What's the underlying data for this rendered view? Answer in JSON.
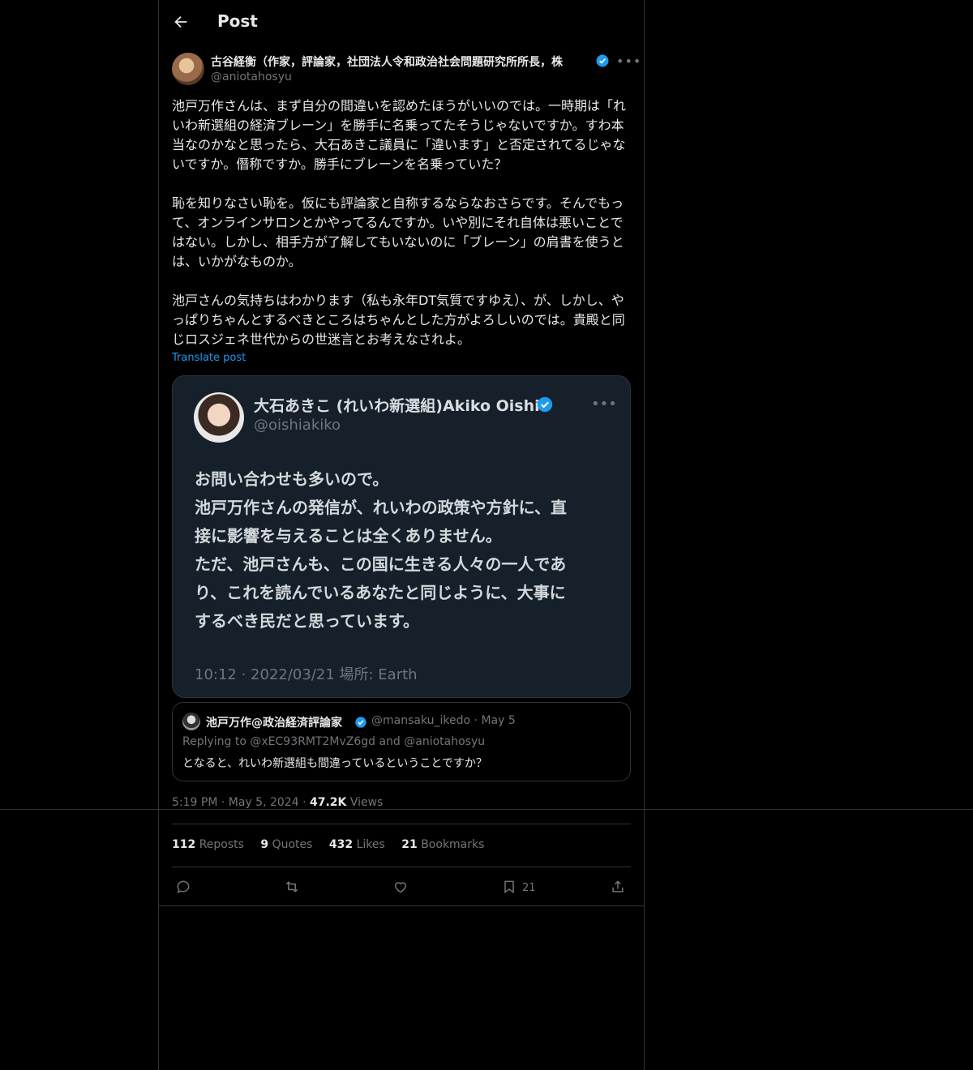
{
  "header": {
    "title": "Post"
  },
  "post": {
    "author_name": "古谷経衡（作家，評論家，社団法人令和政治社会問題研究所所長，株",
    "author_handle": "@aniotahosyu",
    "paragraphs": [
      "池戸万作さんは、まず自分の間違いを認めたほうがいいのでは。一時期は「れいわ新選組の経済ブレーン」を勝手に名乗ってたそうじゃないですか。すわ本当なのかなと思ったら、大石あきこ議員に「違います」と否定されてるじゃないですか。僭称ですか。勝手にブレーンを名乗っていた？",
      "恥を知りなさい恥を。仮にも評論家と自称するならなおさらです。そんでもって、オンラインサロンとかやってるんですか。いや別にそれ自体は悪いことではない。しかし、相手方が了解してもいないのに「ブレーン」の肩書を使うとは、いかがなものか。",
      "池戸さんの気持ちはわかります（私も永年DT気質ですゆえ）、が、しかし、やっぱりちゃんとするべきところはちゃんとした方がよろしいのでは。貴殿と同じロスジェネ世代からの世迷言とお考えなされよ。"
    ],
    "translate_label": "Translate post",
    "media": {
      "name": "大石あきこ (れいわ新選組)Akiko Oishi",
      "handle": "@oishiakiko",
      "lines": [
        "お問い合わせも多いので。",
        "池戸万作さんの発信が、れいわの政策や方針に、直",
        "接に影響を与えることは全くありません。",
        "ただ、池戸さんも、この国に生きる人々の一人であ",
        "り、これを読んでいるあなたと同じように、大事に",
        "するべき民だと思っています。"
      ],
      "time": "10:12 · 2022/03/21 場所: Earth"
    },
    "quote": {
      "name": "池戸万作@政治経済評論家",
      "handle": "@mansaku_ikedo",
      "date": "May 5",
      "replying_prefix": "Replying to ",
      "replying_to": "@xEC93RMT2MvZ6gd",
      "replying_and": " and ",
      "replying_to2": "@aniotahosyu",
      "text": "となると、れいわ新選組も間違っているということですか？"
    },
    "time": "5:19 PM",
    "date": "May 5, 2024",
    "views_count": "47.2K",
    "views_label": "Views",
    "stats": {
      "reposts_count": "112",
      "reposts_label": "Reposts",
      "quotes_count": "9",
      "quotes_label": "Quotes",
      "likes_count": "432",
      "likes_label": "Likes",
      "bookmarks_count": "21",
      "bookmarks_label": "Bookmarks"
    },
    "actions": {
      "bookmark_count": "21"
    }
  },
  "icons": [
    "arrow-left-icon",
    "verified-icon",
    "more-icon",
    "reply-icon",
    "repost-icon",
    "heart-icon",
    "bookmark-icon",
    "share-icon"
  ],
  "colors": {
    "background": "#000000",
    "text": "#e7e9ea",
    "muted": "#71767b",
    "accent": "#1d9bf0",
    "border": "#2f3336"
  }
}
